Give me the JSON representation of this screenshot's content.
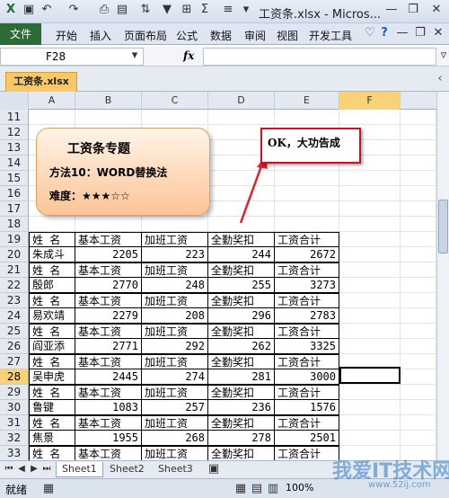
{
  "window": {
    "title": "工资条.xlsx - Micros..."
  },
  "menu": {
    "file": "文件",
    "items": [
      "开始",
      "插入",
      "页面布局",
      "公式",
      "数据",
      "审阅",
      "视图",
      "开发工具"
    ]
  },
  "formula_bar": {
    "name_box": "F28",
    "fx": "fx",
    "value": ""
  },
  "workbook_tab": "工资条.xlsx",
  "columns": [
    "A",
    "B",
    "C",
    "D",
    "E",
    "F"
  ],
  "rows": [
    11,
    12,
    13,
    14,
    15,
    16,
    17,
    18,
    19,
    20,
    21,
    22,
    23,
    24,
    25,
    26,
    27,
    28,
    29,
    30,
    31,
    32,
    33
  ],
  "selected_row": 28,
  "selected_cell": "F28",
  "callout": {
    "title": "工资条专题",
    "method": "方法10：WORD替换法",
    "difficulty": "难度：★★★☆☆"
  },
  "annotation": "OK，大功告成",
  "table_header": [
    "姓 名",
    "基本工资",
    "加班工资",
    "全勤奖扣",
    "工资合计"
  ],
  "employees": [
    {
      "name": "朱成斗",
      "base": 2205,
      "overtime": 223,
      "attendance": 244,
      "total": 2672
    },
    {
      "name": "殷郎",
      "base": 2770,
      "overtime": 248,
      "attendance": 255,
      "total": 3273
    },
    {
      "name": "易欢靖",
      "base": 2279,
      "overtime": 208,
      "attendance": 296,
      "total": 2783
    },
    {
      "name": "阎亚添",
      "base": 2771,
      "overtime": 292,
      "attendance": 262,
      "total": 3325
    },
    {
      "name": "吴申虎",
      "base": 2445,
      "overtime": 274,
      "attendance": 281,
      "total": 3000
    },
    {
      "name": "鲁键",
      "base": 1083,
      "overtime": 257,
      "attendance": 236,
      "total": 1576
    },
    {
      "name": "焦景",
      "base": 1955,
      "overtime": 268,
      "attendance": 278,
      "total": 2501
    }
  ],
  "sheets": [
    "Sheet1",
    "Sheet2",
    "Sheet3"
  ],
  "active_sheet": "Sheet1",
  "status": {
    "ready": "就绪",
    "zoom": "100%"
  },
  "watermark": {
    "main": "我爱IT技术网",
    "url": "www.52ij.com"
  },
  "colors": {
    "file_tab": "#2c6a37",
    "callout_border": "#e79d5d",
    "annotation_border": "#d01020",
    "arrow": "#e0202a",
    "selected_row": "#f7d277"
  }
}
